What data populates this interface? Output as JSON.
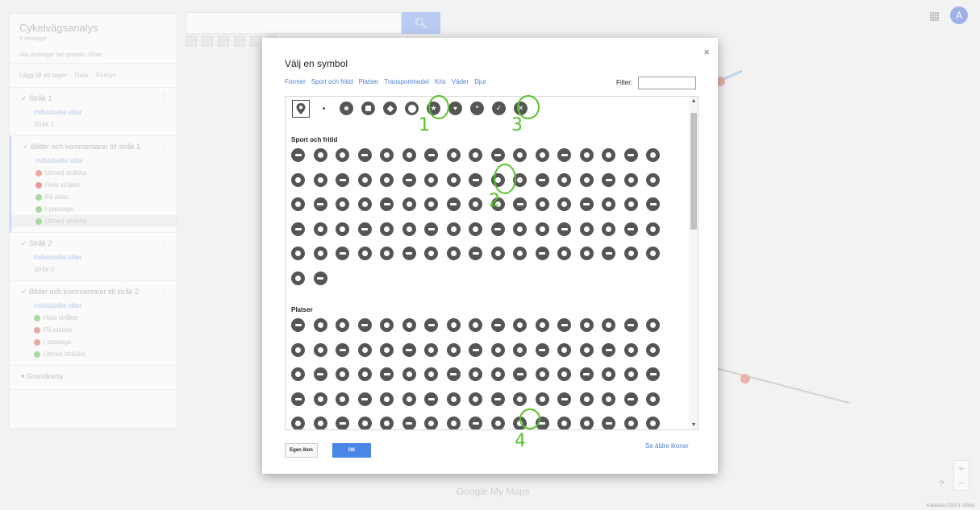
{
  "map_panel": {
    "title": "Cykelvägsanalys",
    "subtitle": "8 visningar",
    "saved_status": "Alla ändringar har sparats i Drive",
    "actions": {
      "add_layer": "Lägg till ett lager",
      "share": "Dela",
      "preview": "Förhyn"
    },
    "layers": [
      {
        "title": "Stråk 1",
        "style": "Individuella stilar",
        "items": [
          {
            "label": "Stråk 1",
            "color": "#cccccc"
          }
        ]
      },
      {
        "title": "Bilder och kommentarer till stråk 1",
        "style": "Individuella stilar",
        "items": [
          {
            "label": "Utmed sträcka",
            "color": "#e9a9a2"
          },
          {
            "label": "Hela stråket",
            "color": "#e99a92"
          },
          {
            "label": "På plats",
            "color": "#a9d8a1"
          },
          {
            "label": "I passage",
            "color": "#a9d8a1"
          },
          {
            "label": "Utmed sträcka",
            "color": "#a9d8a1"
          }
        ]
      },
      {
        "title": "Stråk 2",
        "style": "Individuella stilar",
        "items": [
          {
            "label": "Stråk 2",
            "color": "#cccccc"
          }
        ]
      },
      {
        "title": "Bilder och kommentarer till stråk 2",
        "style": "Individuella stilar",
        "items": [
          {
            "label": "Hela stråket",
            "color": "#a9d8a1"
          },
          {
            "label": "På platser",
            "color": "#e9a9a2"
          },
          {
            "label": "I passage",
            "color": "#e9a9a2"
          },
          {
            "label": "Utmed sträcka",
            "color": "#a9d8a1"
          }
        ]
      }
    ],
    "basemap": "Grundkarta"
  },
  "app": {
    "account_initial": "A",
    "logo": "Google My Maps",
    "attribution": "Kartdata ©2021   Villkor",
    "help": "?"
  },
  "dialog": {
    "title": "Välj en symbol",
    "close": "×",
    "tabs": [
      "Former",
      "Sport och fritid",
      "Platser",
      "Transportmedel",
      "Kris",
      "Väder",
      "Djur"
    ],
    "filter_label": "Filter:",
    "filter_value": "",
    "sections": {
      "sport": "Sport och fritid",
      "places": "Platser"
    },
    "buttons": {
      "own_icon": "Egen ikon",
      "ok": "OK",
      "older_icons": "Se äldre ikoner"
    },
    "icon_color": "#555555",
    "shapes_row_count": 12,
    "sport_rows": [
      17,
      17,
      17,
      17,
      17,
      2
    ],
    "places_rows": [
      17,
      17,
      17,
      17,
      17
    ]
  },
  "annotations": [
    "1",
    "2",
    "3",
    "4"
  ],
  "colors": {
    "accent": "#4a86e8",
    "link": "#4f81d5",
    "annotation": "#57c22a"
  }
}
